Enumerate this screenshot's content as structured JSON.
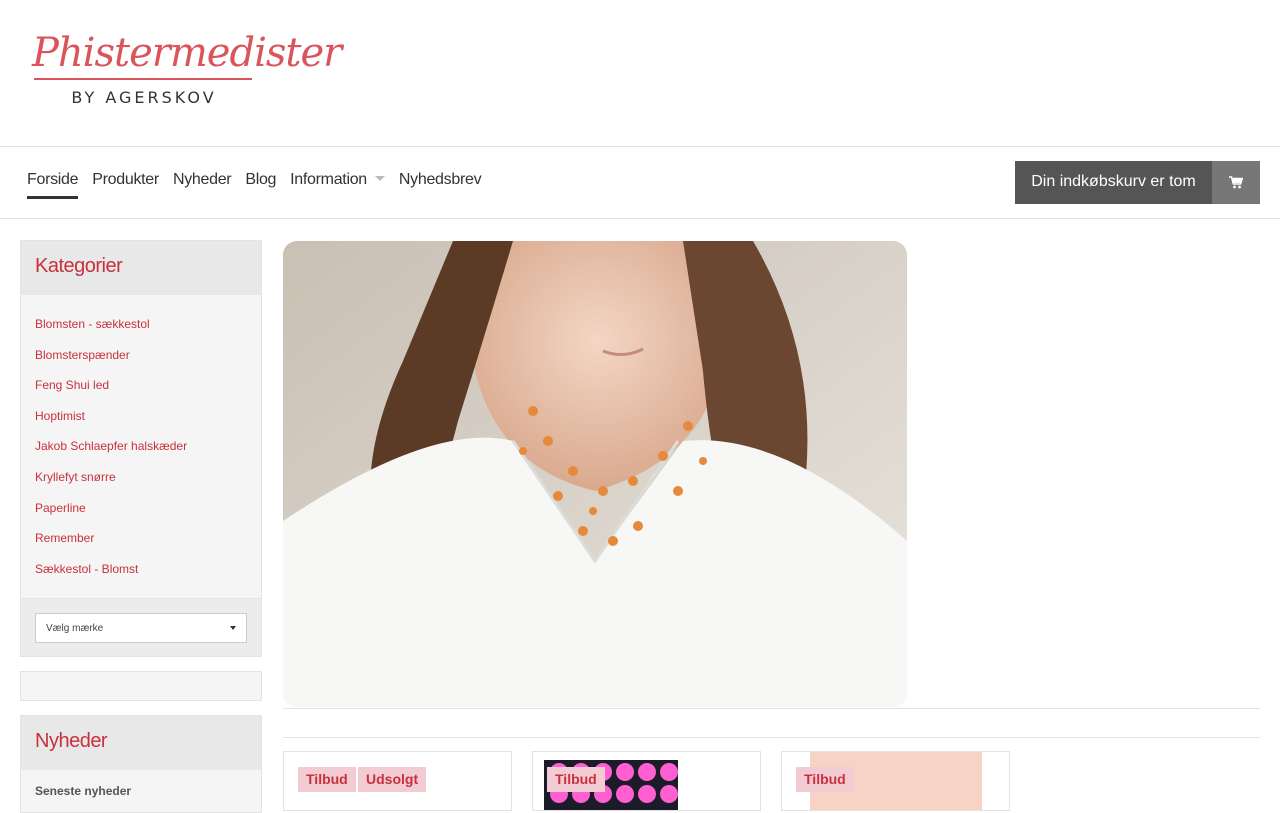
{
  "brand": {
    "name": "Phistermedister",
    "tagline": "BY AGERSKOV"
  },
  "nav": {
    "items": [
      "Forside",
      "Produkter",
      "Nyheder",
      "Blog",
      "Information",
      "Nyhedsbrev"
    ],
    "active": "Forside"
  },
  "cart": {
    "label": "Din indkøbskurv er tom"
  },
  "sidebar": {
    "categories_title": "Kategorier",
    "categories": [
      "Blomsten - sækkestol",
      "Blomsterspænder",
      "Feng Shui led",
      "Hoptimist",
      "Jakob Schlaepfer halskæder",
      "Kryllefyt snørre",
      "Paperline",
      "Remember",
      "Sækkestol - Blomst"
    ],
    "brand_select": "Vælg mærke",
    "news_title": "Nyheder",
    "news_subtitle": "Seneste nyheder"
  },
  "products": [
    {
      "badges": [
        "Tilbud",
        "Udsolgt"
      ]
    },
    {
      "badges": [
        "Tilbud"
      ]
    },
    {
      "badges": [
        "Tilbud"
      ]
    }
  ],
  "colors": {
    "accent": "#c8313c",
    "logo": "#d9555b",
    "cart_bg": "#555555",
    "badge_bg": "#f3cbd2"
  },
  "icons": {
    "cart": "shopping-cart-icon",
    "dropdown": "caret-down-icon"
  }
}
